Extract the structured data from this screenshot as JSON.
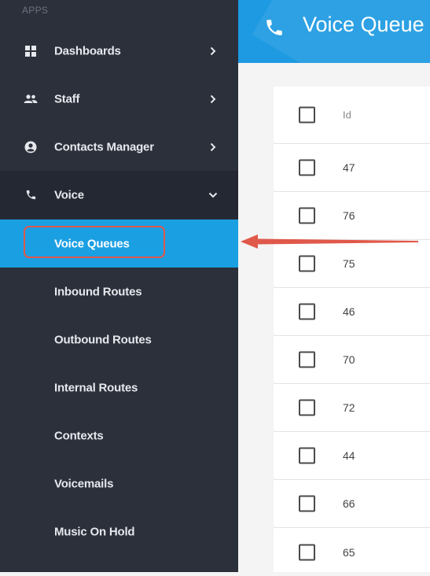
{
  "sidebar": {
    "section_label": "APPS",
    "items": [
      {
        "label": "Dashboards",
        "icon": "dashboard-icon"
      },
      {
        "label": "Staff",
        "icon": "people-icon"
      },
      {
        "label": "Contacts Manager",
        "icon": "account-circle-icon"
      },
      {
        "label": "Voice",
        "icon": "phone-icon"
      }
    ],
    "voice_subitems": [
      {
        "label": "Voice Queues",
        "active": true
      },
      {
        "label": "Inbound Routes"
      },
      {
        "label": "Outbound Routes"
      },
      {
        "label": "Internal Routes"
      },
      {
        "label": "Contexts"
      },
      {
        "label": "Voicemails"
      },
      {
        "label": "Music On Hold"
      }
    ]
  },
  "header": {
    "title": "Voice Queue",
    "icon": "phone-icon",
    "color": "#1e9ae2"
  },
  "table": {
    "column_header": "Id",
    "rows": [
      "47",
      "76",
      "75",
      "46",
      "70",
      "72",
      "44",
      "66",
      "65"
    ]
  },
  "annotation": {
    "arrow_color": "#e0584a",
    "highlight_color": "#e0584a"
  },
  "colors": {
    "sidebar_bg": "#2b303b",
    "active_bg": "#1a9fe3"
  }
}
